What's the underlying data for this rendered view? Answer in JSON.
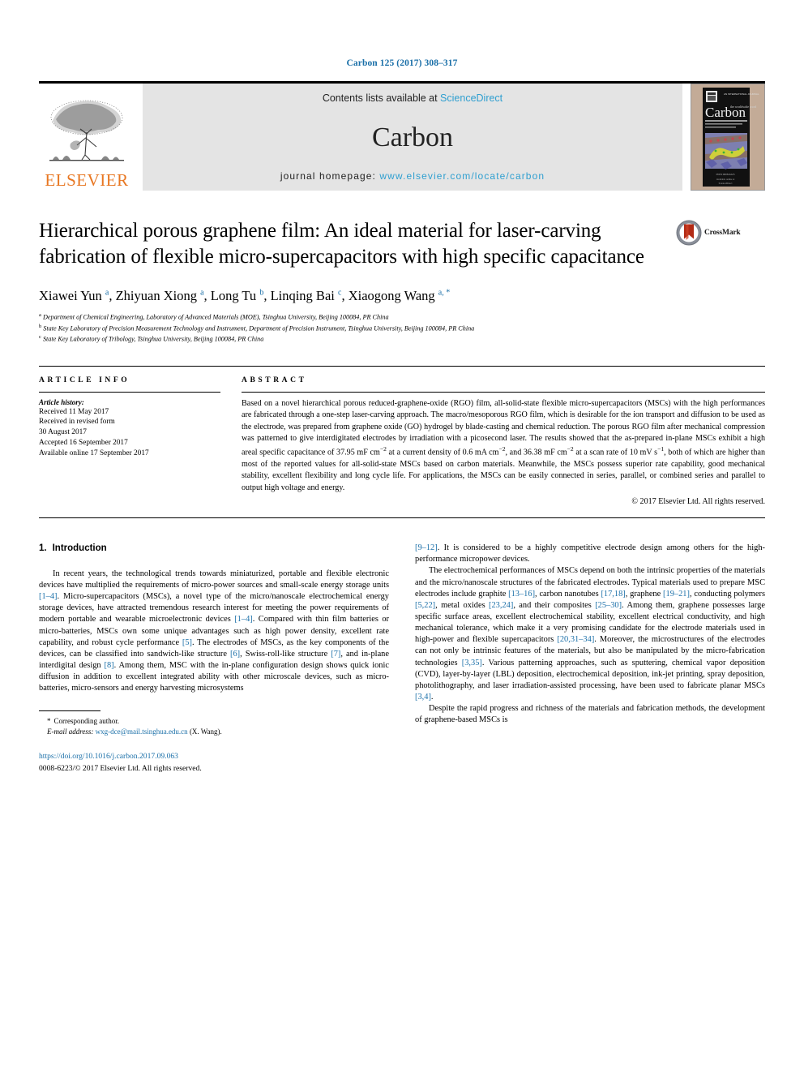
{
  "header": {
    "running_head": "Carbon 125 (2017) 308–317",
    "running_head_color": "#1a6fa8"
  },
  "masthead": {
    "publisher_name": "ELSEVIER",
    "publisher_color": "#e87722",
    "contents_prefix": "Contents lists available at ",
    "contents_link": "ScienceDirect",
    "journal_name": "Carbon",
    "homepage_prefix": "journal homepage: ",
    "homepage_url": "www.elsevier.com/locate/carbon",
    "link_color": "#2f9fd0",
    "cover_title": "Carbon"
  },
  "article": {
    "title": "Hierarchical porous graphene film: An ideal material for laser-carving fabrication of flexible micro-supercapacitors with high specific capacitance",
    "crossmark_label": "CrossMark",
    "authors_html": "Xiawei Yun <sup>a</sup>, Zhiyuan Xiong <sup>a</sup>, Long Tu <sup>b</sup>, Linqing Bai <sup>c</sup>, Xiaogong Wang <sup>a, *</sup>",
    "affiliations": [
      "Department of Chemical Engineering, Laboratory of Advanced Materials (MOE), Tsinghua University, Beijing 100084, PR China",
      "State Key Laboratory of Precision Measurement Technology and Instrument, Department of Precision Instrument, Tsinghua University, Beijing 100084, PR China",
      "State Key Laboratory of Tribology, Tsinghua University, Beijing 100084, PR China"
    ],
    "affiliation_marks": [
      "a",
      "b",
      "c"
    ]
  },
  "info": {
    "heading": "ARTICLE INFO",
    "history_label": "Article history:",
    "history": [
      "Received 11 May 2017",
      "Received in revised form",
      "30 August 2017",
      "Accepted 16 September 2017",
      "Available online 17 September 2017"
    ]
  },
  "abstract": {
    "heading": "ABSTRACT",
    "text": "Based on a novel hierarchical porous reduced-graphene-oxide (RGO) film, all-solid-state flexible micro-supercapacitors (MSCs) with the high performances are fabricated through a one-step laser-carving approach. The macro/mesoporous RGO film, which is desirable for the ion transport and diffusion to be used as the electrode, was prepared from graphene oxide (GO) hydrogel by blade-casting and chemical reduction. The porous RGO film after mechanical compression was patterned to give interdigitated electrodes by irradiation with a picosecond laser. The results showed that the as-prepared in-plane MSCs exhibit a high areal specific capacitance of 37.95 mF cm−2 at a current density of 0.6 mA cm−2, and 36.38 mF cm−2 at a scan rate of 10 mV s−1, both of which are higher than most of the reported values for all-solid-state MSCs based on carbon materials. Meanwhile, the MSCs possess superior rate capability, good mechanical stability, excellent flexibility and long cycle life. For applications, the MSCs can be easily connected in series, parallel, or combined series and parallel to output high voltage and energy.",
    "copyright": "© 2017 Elsevier Ltd. All rights reserved."
  },
  "body": {
    "section_number": "1.",
    "section_title": "Introduction",
    "left_paragraph_1": "In recent years, the technological trends towards miniaturized, portable and flexible electronic devices have multiplied the requirements of micro-power sources and small-scale energy storage units [1–4]. Micro-supercapacitors (MSCs), a novel type of the micro/nanoscale electrochemical energy storage devices, have attracted tremendous research interest for meeting the power requirements of modern portable and wearable microelectronic devices [1–4]. Compared with thin film batteries or micro-batteries, MSCs own some unique advantages such as high power density, excellent rate capability, and robust cycle performance [5]. The electrodes of MSCs, as the key components of the devices, can be classified into sandwich-like structure [6], Swiss-roll-like structure [7], and in-plane interdigital design [8]. Among them, MSC with the in-plane configuration design shows quick ionic diffusion in addition to excellent integrated ability with other microscale devices, such as micro-batteries, micro-sensors and energy harvesting microsystems",
    "right_paragraph_1": "[9–12]. It is considered to be a highly competitive electrode design among others for the high-performance micropower devices.",
    "right_paragraph_2": "The electrochemical performances of MSCs depend on both the intrinsic properties of the materials and the micro/nanoscale structures of the fabricated electrodes. Typical materials used to prepare MSC electrodes include graphite [13–16], carbon nanotubes [17,18], graphene [19–21], conducting polymers [5,22], metal oxides [23,24], and their composites [25–30]. Among them, graphene possesses large specific surface areas, excellent electrochemical stability, excellent electrical conductivity, and high mechanical tolerance, which make it a very promising candidate for the electrode materials used in high-power and flexible supercapacitors [20,31–34]. Moreover, the microstructures of the electrodes can not only be intrinsic features of the materials, but also be manipulated by the micro-fabrication technologies [3,35]. Various patterning approaches, such as sputtering, chemical vapor deposition (CVD), layer-by-layer (LBL) deposition, electrochemical deposition, ink-jet printing, spray deposition, photolithography, and laser irradiation-assisted processing, have been used to fabricate planar MSCs [3,4].",
    "right_paragraph_3": "Despite the rapid progress and richness of the materials and fabrication methods, the development of graphene-based MSCs is"
  },
  "footnote": {
    "star": "*",
    "corresponding": "Corresponding author.",
    "email_label": "E-mail address:",
    "email": "wxg-dce@mail.tsinghua.edu.cn",
    "email_suffix": "(X. Wang).",
    "doi": "https://doi.org/10.1016/j.carbon.2017.09.063",
    "issn_line": "0008-6223/© 2017 Elsevier Ltd. All rights reserved."
  }
}
